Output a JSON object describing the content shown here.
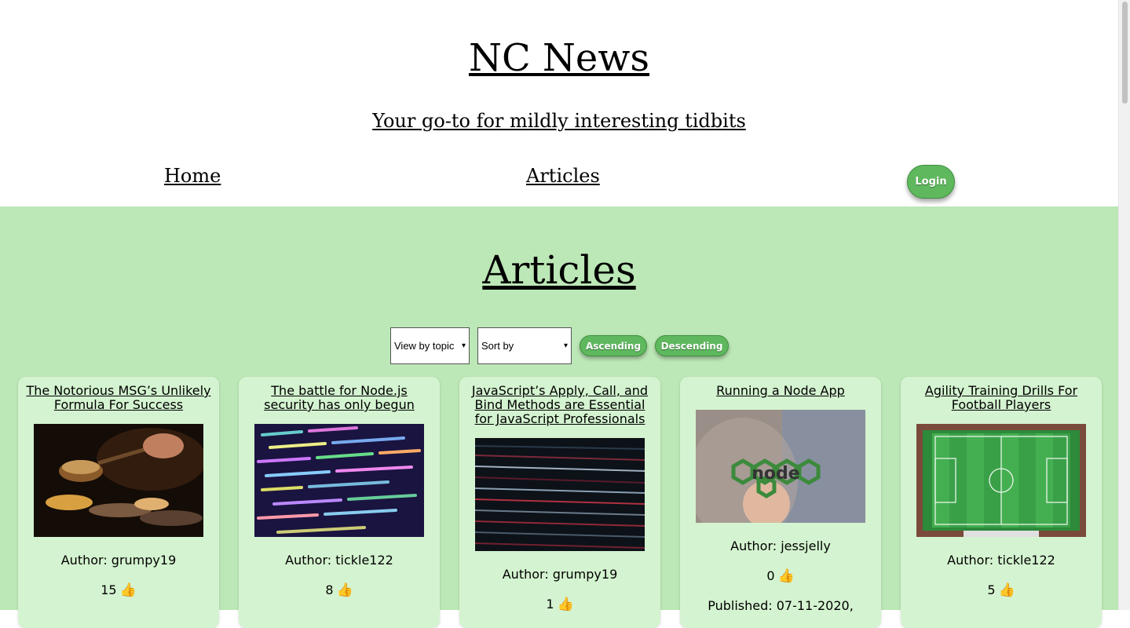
{
  "header": {
    "site_title": "NC News",
    "tagline": "Your go-to for mildly interesting tidbits",
    "nav": {
      "home": "Home",
      "articles": "Articles"
    },
    "login": "Login"
  },
  "main": {
    "heading": "Articles",
    "controls": {
      "topic_select": "View by topic",
      "sort_select": "Sort by",
      "ascending": "Ascending",
      "descending": "Descending"
    },
    "cards": [
      {
        "title": "The Notorious MSG’s Unlikely Formula For Success",
        "author": "Author: grumpy19",
        "votes": "15",
        "image": "cooking-image"
      },
      {
        "title": "The battle for Node.js security has only begun",
        "author": "Author: tickle122",
        "votes": "8",
        "image": "code-screen-image"
      },
      {
        "title": "JavaScript’s Apply, Call, and Bind Methods are Essential for JavaScript Professionals",
        "author": "Author: grumpy19",
        "votes": "1",
        "image": "code-monitor-image"
      },
      {
        "title": "Running a Node App",
        "author": "Author: jessjelly",
        "votes": "0",
        "published": "Published: 07-11-2020,",
        "image": "node-sticker-image"
      },
      {
        "title": "Agility Training Drills For Football Players",
        "author": "Author: tickle122",
        "votes": "5",
        "image": "football-pitch-image"
      }
    ],
    "vote_icon": "thumbs-up-icon"
  },
  "colors": {
    "main_bg": "#bce7b6",
    "card_bg": "#d4f3d0",
    "button_green": "#5fb85e"
  }
}
